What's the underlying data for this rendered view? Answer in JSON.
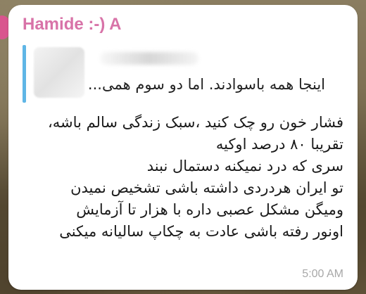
{
  "message": {
    "sender": "Hamide :-) A",
    "quote": {
      "text": "اینجا همه باسوادند. اما دو سوم همی..."
    },
    "lines": [
      "فشار خون رو چک کنید ،سبک زندگی سالم باشه،",
      "تقریبا ۸۰ درصد اوکیه",
      "سری که درد نمیکنه دستمال نبند",
      "تو ایران  هردردی داشته باشی تشخیص نمیدن",
      "ومیگن مشکل عصبی داره با هزار تا آزمایش",
      "اونور رفته باشی عادت به چکاپ سالیانه میکنی"
    ],
    "time": "5:00 AM"
  },
  "colors": {
    "sender": "#d873a8",
    "quote_bar": "#5fb6e6",
    "avatar": "#d9558e"
  }
}
